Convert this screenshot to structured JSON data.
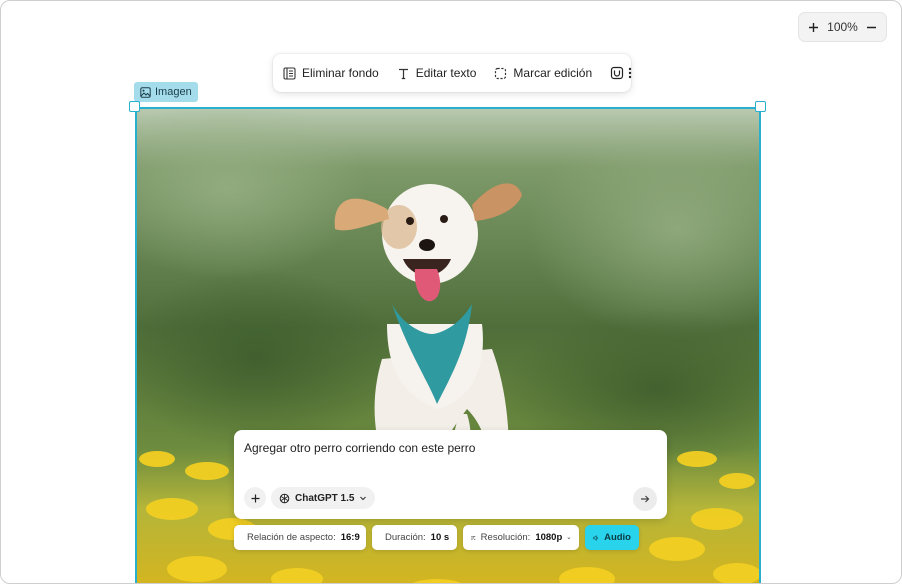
{
  "zoom": {
    "level": "100%",
    "zoom_in_label": "+",
    "zoom_out_label": "−"
  },
  "toolbar": {
    "remove_bg": "Eliminar fondo",
    "edit_text": "Editar texto",
    "mark_edit": "Marcar edición",
    "icons": [
      "remove-background-icon",
      "text-icon",
      "marquee-select-icon",
      "cut-icon",
      "more-vertical-icon"
    ]
  },
  "selection": {
    "label": "Imagen",
    "accent_color": "#2ab0cf",
    "label_color": "#a5dcec"
  },
  "prompt": {
    "text": "Agregar otro perro corriendo con este perro",
    "model": "ChatGPT 1.5"
  },
  "options": {
    "aspect_label": "Relación de aspecto:",
    "aspect_value": "16:9",
    "duration_label": "Duración:",
    "duration_value": "10 s",
    "resolution_label": "Resolución:",
    "resolution_value": "1080p",
    "audio_label": "Audio",
    "audio_color": "#29d3ec"
  }
}
